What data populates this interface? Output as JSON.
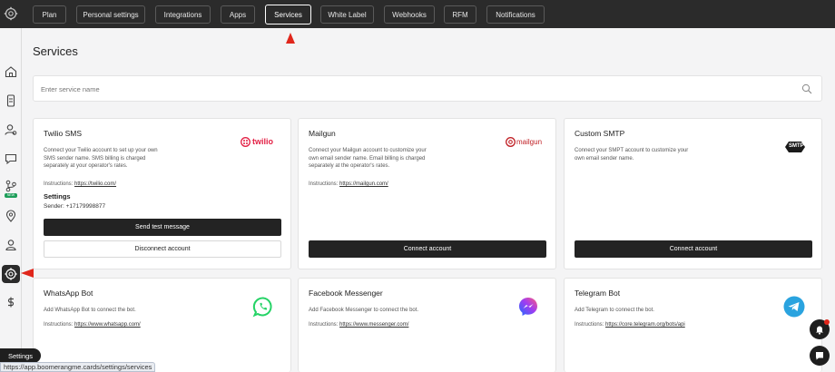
{
  "topbar": {
    "tabs": [
      {
        "label": "Plan"
      },
      {
        "label": "Personal settings"
      },
      {
        "label": "Integrations"
      },
      {
        "label": "Apps"
      },
      {
        "label": "Services"
      },
      {
        "label": "White Label"
      },
      {
        "label": "Webhooks"
      },
      {
        "label": "RFM"
      },
      {
        "label": "Notifications"
      }
    ],
    "active_tab": "Services"
  },
  "sidebar": {
    "items": [
      "gear-icon",
      "home-icon",
      "card-icon",
      "users-icon",
      "chat-icon",
      "flow-icon",
      "location-icon",
      "person-icon",
      "settings-icon",
      "dollar-icon"
    ],
    "flow_badge": "NEW",
    "tooltip": "Settings"
  },
  "page": {
    "title": "Services"
  },
  "search": {
    "placeholder": "Enter service name"
  },
  "cards": {
    "twilio": {
      "title": "Twilio SMS",
      "description": "Connect your Twilio account to set up your own SMS sender name. SMS billing is charged separately at your operator's rates.",
      "instructions_label": "Instructions:",
      "instructions_link": "https://twilio.com/",
      "settings_heading": "Settings",
      "sender": "Sender: +17179998877",
      "test_button": "Send test message",
      "disconnect_button": "Disconnect account",
      "logo_text": "twilio"
    },
    "mailgun": {
      "title": "Mailgun",
      "description": "Connect your Mailgun account to customize your own email sender name. Email billing is charged separately at the operator's rates.",
      "instructions_label": "Instructions:",
      "instructions_link": "https://mailgun.com/",
      "connect_button": "Connect account",
      "logo_text": "mailgun"
    },
    "smtp": {
      "title": "Custom SMTP",
      "description": "Connect your SMPT account to customize your own email sender name.",
      "connect_button": "Connect account",
      "logo_text": "SMTP"
    },
    "whatsapp": {
      "title": "WhatsApp Bot",
      "description": "Add WhatsApp Bot to connect the bot.",
      "instructions_label": "Instructions:",
      "instructions_link": "https://www.whatsapp.com/"
    },
    "messenger": {
      "title": "Facebook Messenger",
      "description": "Add Facebook Messenger to connect the bot.",
      "instructions_label": "Instructions:",
      "instructions_link": "https://www.messenger.com/"
    },
    "telegram": {
      "title": "Telegram Bot",
      "description": "Add Telegram to connect the bot.",
      "instructions_label": "Instructions:",
      "instructions_link": "https://core.telegram.org/bots/api"
    }
  },
  "statusbar": {
    "url": "https://app.boomerangme.cards/settings/services"
  },
  "colors": {
    "topbar": "#2b2b2b",
    "button_dark": "#232323",
    "twilio": "#e31e43",
    "mailgun": "#c02126",
    "whatsapp": "#25d366",
    "telegram": "#2aa3df",
    "annotation_arrow": "#e0261b"
  }
}
